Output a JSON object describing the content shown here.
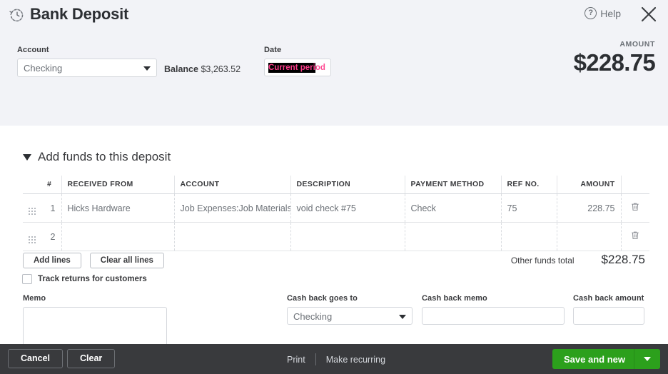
{
  "header": {
    "title": "Bank Deposit",
    "title_icon": "recurring-clock-icon",
    "help_label": "Help",
    "help_icon": "question-mark-icon",
    "close_icon": "close-x-icon",
    "account": {
      "label": "Account",
      "value": "Checking"
    },
    "balance": {
      "label": "Balance",
      "value": "$3,263.52"
    },
    "date": {
      "label": "Date",
      "value_selected": "Current peri",
      "value_unselected": "od",
      "full_value": "Current period",
      "text_color": "#ff3d8b",
      "selection_color": "#000000"
    },
    "amount": {
      "label": "AMOUNT",
      "value": "$228.75"
    }
  },
  "section": {
    "title": "Add funds to this deposit",
    "toggle_icon": "chevron-down-icon"
  },
  "table": {
    "columns": [
      "",
      "#",
      "RECEIVED FROM",
      "ACCOUNT",
      "DESCRIPTION",
      "PAYMENT METHOD",
      "REF NO.",
      "AMOUNT",
      ""
    ],
    "rows": [
      {
        "index": "1",
        "received_from": "Hicks Hardware",
        "account": "Job Expenses:Job Materials",
        "description": "void check #75",
        "payment_method": "Check",
        "ref_no": "75",
        "amount": "228.75"
      },
      {
        "index": "2",
        "received_from": "",
        "account": "",
        "description": "",
        "payment_method": "",
        "ref_no": "",
        "amount": ""
      }
    ]
  },
  "actions": {
    "add_lines": "Add lines",
    "clear_all_lines": "Clear all lines",
    "track_returns": "Track returns for customers"
  },
  "totals": {
    "label": "Other funds total",
    "value": "$228.75"
  },
  "lower": {
    "memo_label": "Memo",
    "memo_value": "",
    "cash_back_goes_to_label": "Cash back goes to",
    "cash_back_goes_to_value": "Checking",
    "cash_back_memo_label": "Cash back memo",
    "cash_back_memo_value": "",
    "cash_back_amount_label": "Cash back amount",
    "cash_back_amount_value": ""
  },
  "footer": {
    "cancel": "Cancel",
    "clear": "Clear",
    "print": "Print",
    "make_recurring": "Make recurring",
    "save_and_new": "Save and new",
    "save_dropdown_icon": "chevron-down-icon",
    "accent_color": "#2ca01c",
    "background_color": "#393a3d"
  }
}
